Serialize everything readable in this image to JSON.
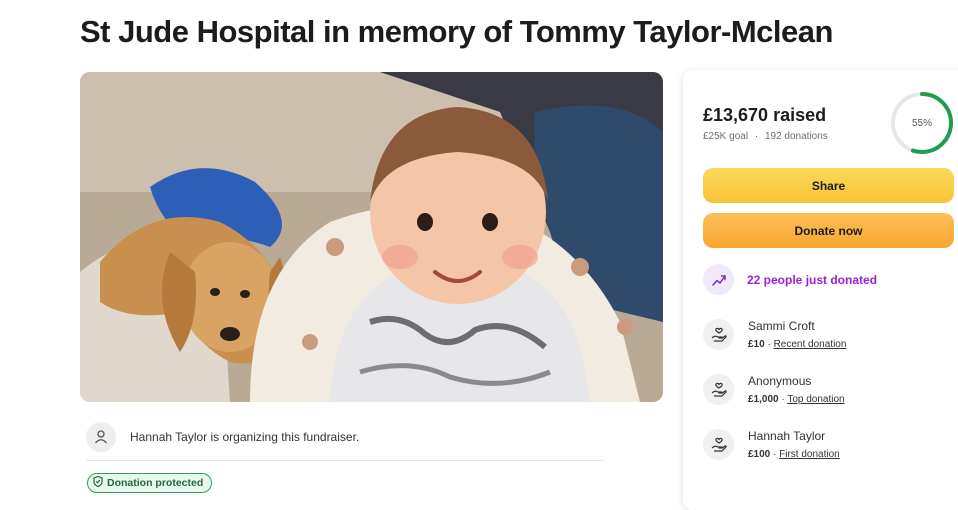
{
  "page": {
    "title": "St Jude Hospital in memory of Tommy Taylor-Mclean"
  },
  "organizer": {
    "text": "Hannah Taylor is organizing this fundraiser.",
    "icon": "person-icon"
  },
  "badge": {
    "label": "Donation protected",
    "icon": "shield-icon",
    "color": "#2fa25a"
  },
  "sidebar": {
    "raised": "£13,670 raised",
    "goal": "£25K goal",
    "donations": "192 donations",
    "separator": "·",
    "progress_label": "55%",
    "progress_fraction": 0.55,
    "share_label": "Share",
    "donate_label": "Donate now",
    "recent_text": "22 people just donated",
    "recent_icon": "trending-up-icon",
    "donors": [
      {
        "name": "Sammi Croft",
        "amount": "£10",
        "tag": "Recent donation"
      },
      {
        "name": "Anonymous",
        "amount": "£1,000",
        "tag": "Top donation"
      },
      {
        "name": "Hannah Taylor",
        "amount": "£100",
        "tag": "First donation"
      }
    ]
  },
  "colors": {
    "share": "#f9c436",
    "donate": "#f9a52d",
    "progress": "#1f9d4f",
    "recent": "#9b1fd9"
  }
}
